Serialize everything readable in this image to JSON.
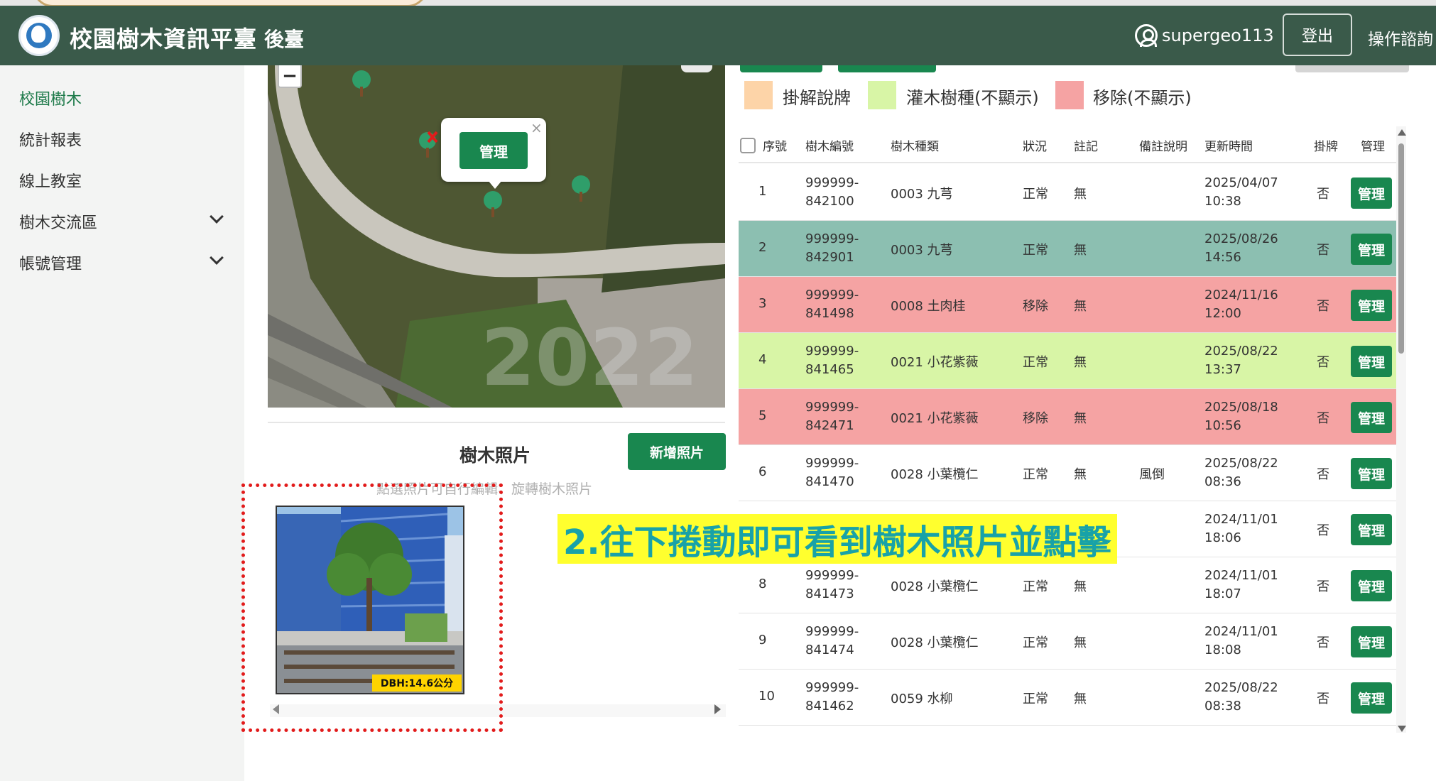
{
  "header": {
    "site_title": "校園樹木資訊平臺",
    "site_sub": "後臺",
    "username": "supergeo113",
    "logout_label": "登出",
    "help_label": "操作諮詢",
    "brand_color": "#3a5a4a"
  },
  "sidebar": {
    "items": [
      {
        "label": "校園樹木",
        "active": true
      },
      {
        "label": "統計報表"
      },
      {
        "label": "線上教室"
      },
      {
        "label": "樹木交流區",
        "expandable": true
      },
      {
        "label": "帳號管理",
        "expandable": true
      }
    ]
  },
  "map": {
    "zoom_out_label": "−",
    "popup_close": "×",
    "popup_button": "管理",
    "watermark": "2022"
  },
  "photos": {
    "title": "樹木照片",
    "add_button": "新增照片",
    "hint": "點選照片可自行編輯、旋轉樹木照片",
    "dbh_label": "DBH:14.6公分"
  },
  "legend": [
    {
      "label": "掛解說牌",
      "color": "#fdd4a8"
    },
    {
      "label": "灌木樹種(不顯示)",
      "color": "#d8f5a6"
    },
    {
      "label": "移除(不顯示)",
      "color": "#f5a3a3"
    }
  ],
  "table": {
    "headers": [
      "序號",
      "樹木編號",
      "樹木種類",
      "狀況",
      "註記",
      "備註說明",
      "更新時間",
      "掛牌",
      "管理"
    ],
    "rows": [
      {
        "no": "1",
        "id_line1": "999999-",
        "id_line2": "842100",
        "species": "0003 九芎",
        "status": "正常",
        "mark": "無",
        "note": "",
        "date": "2025/04/07",
        "time": "10:38",
        "tag": "否",
        "action": "管理",
        "bg": "#ffffff"
      },
      {
        "no": "2",
        "id_line1": "999999-",
        "id_line2": "842901",
        "species": "0003 九芎",
        "status": "正常",
        "mark": "無",
        "note": "",
        "date": "2025/08/26",
        "time": "14:56",
        "tag": "否",
        "action": "管理",
        "bg": "#8cbfb1"
      },
      {
        "no": "3",
        "id_line1": "999999-",
        "id_line2": "841498",
        "species": "0008 土肉桂",
        "status": "移除",
        "mark": "無",
        "note": "",
        "date": "2024/11/16",
        "time": "12:00",
        "tag": "否",
        "action": "管理",
        "bg": "#f5a3a3"
      },
      {
        "no": "4",
        "id_line1": "999999-",
        "id_line2": "841465",
        "species": "0021 小花紫薇",
        "status": "正常",
        "mark": "無",
        "note": "",
        "date": "2025/08/22",
        "time": "13:37",
        "tag": "否",
        "action": "管理",
        "bg": "#d8f5a6"
      },
      {
        "no": "5",
        "id_line1": "999999-",
        "id_line2": "842471",
        "species": "0021 小花紫薇",
        "status": "移除",
        "mark": "無",
        "note": "",
        "date": "2025/08/18",
        "time": "10:56",
        "tag": "否",
        "action": "管理",
        "bg": "#f5a3a3"
      },
      {
        "no": "6",
        "id_line1": "999999-",
        "id_line2": "841470",
        "species": "0028 小葉欖仁",
        "status": "正常",
        "mark": "無",
        "note": "風倒",
        "date": "2025/08/22",
        "time": "08:36",
        "tag": "否",
        "action": "管理",
        "bg": "#ffffff"
      },
      {
        "no": "",
        "id_line1": "",
        "id_line2": "",
        "species": "",
        "status": "",
        "mark": "",
        "note": "",
        "date": "2024/11/01",
        "time": "18:06",
        "tag": "否",
        "action": "管理",
        "bg": "#ffffff"
      },
      {
        "no": "8",
        "id_line1": "999999-",
        "id_line2": "841473",
        "species": "0028 小葉欖仁",
        "status": "正常",
        "mark": "無",
        "note": "",
        "date": "2024/11/01",
        "time": "18:07",
        "tag": "否",
        "action": "管理",
        "bg": "#ffffff"
      },
      {
        "no": "9",
        "id_line1": "999999-",
        "id_line2": "841474",
        "species": "0028 小葉欖仁",
        "status": "正常",
        "mark": "無",
        "note": "",
        "date": "2024/11/01",
        "time": "18:08",
        "tag": "否",
        "action": "管理",
        "bg": "#ffffff"
      },
      {
        "no": "10",
        "id_line1": "999999-",
        "id_line2": "841462",
        "species": "0059 水柳",
        "status": "正常",
        "mark": "無",
        "note": "",
        "date": "2025/08/22",
        "time": "08:38",
        "tag": "否",
        "action": "管理",
        "bg": "#ffffff"
      }
    ]
  },
  "annotation": {
    "text": "2.往下捲動即可看到樹木照片並點擊",
    "color": "#18a2a8",
    "highlight": "#ffff2e"
  }
}
